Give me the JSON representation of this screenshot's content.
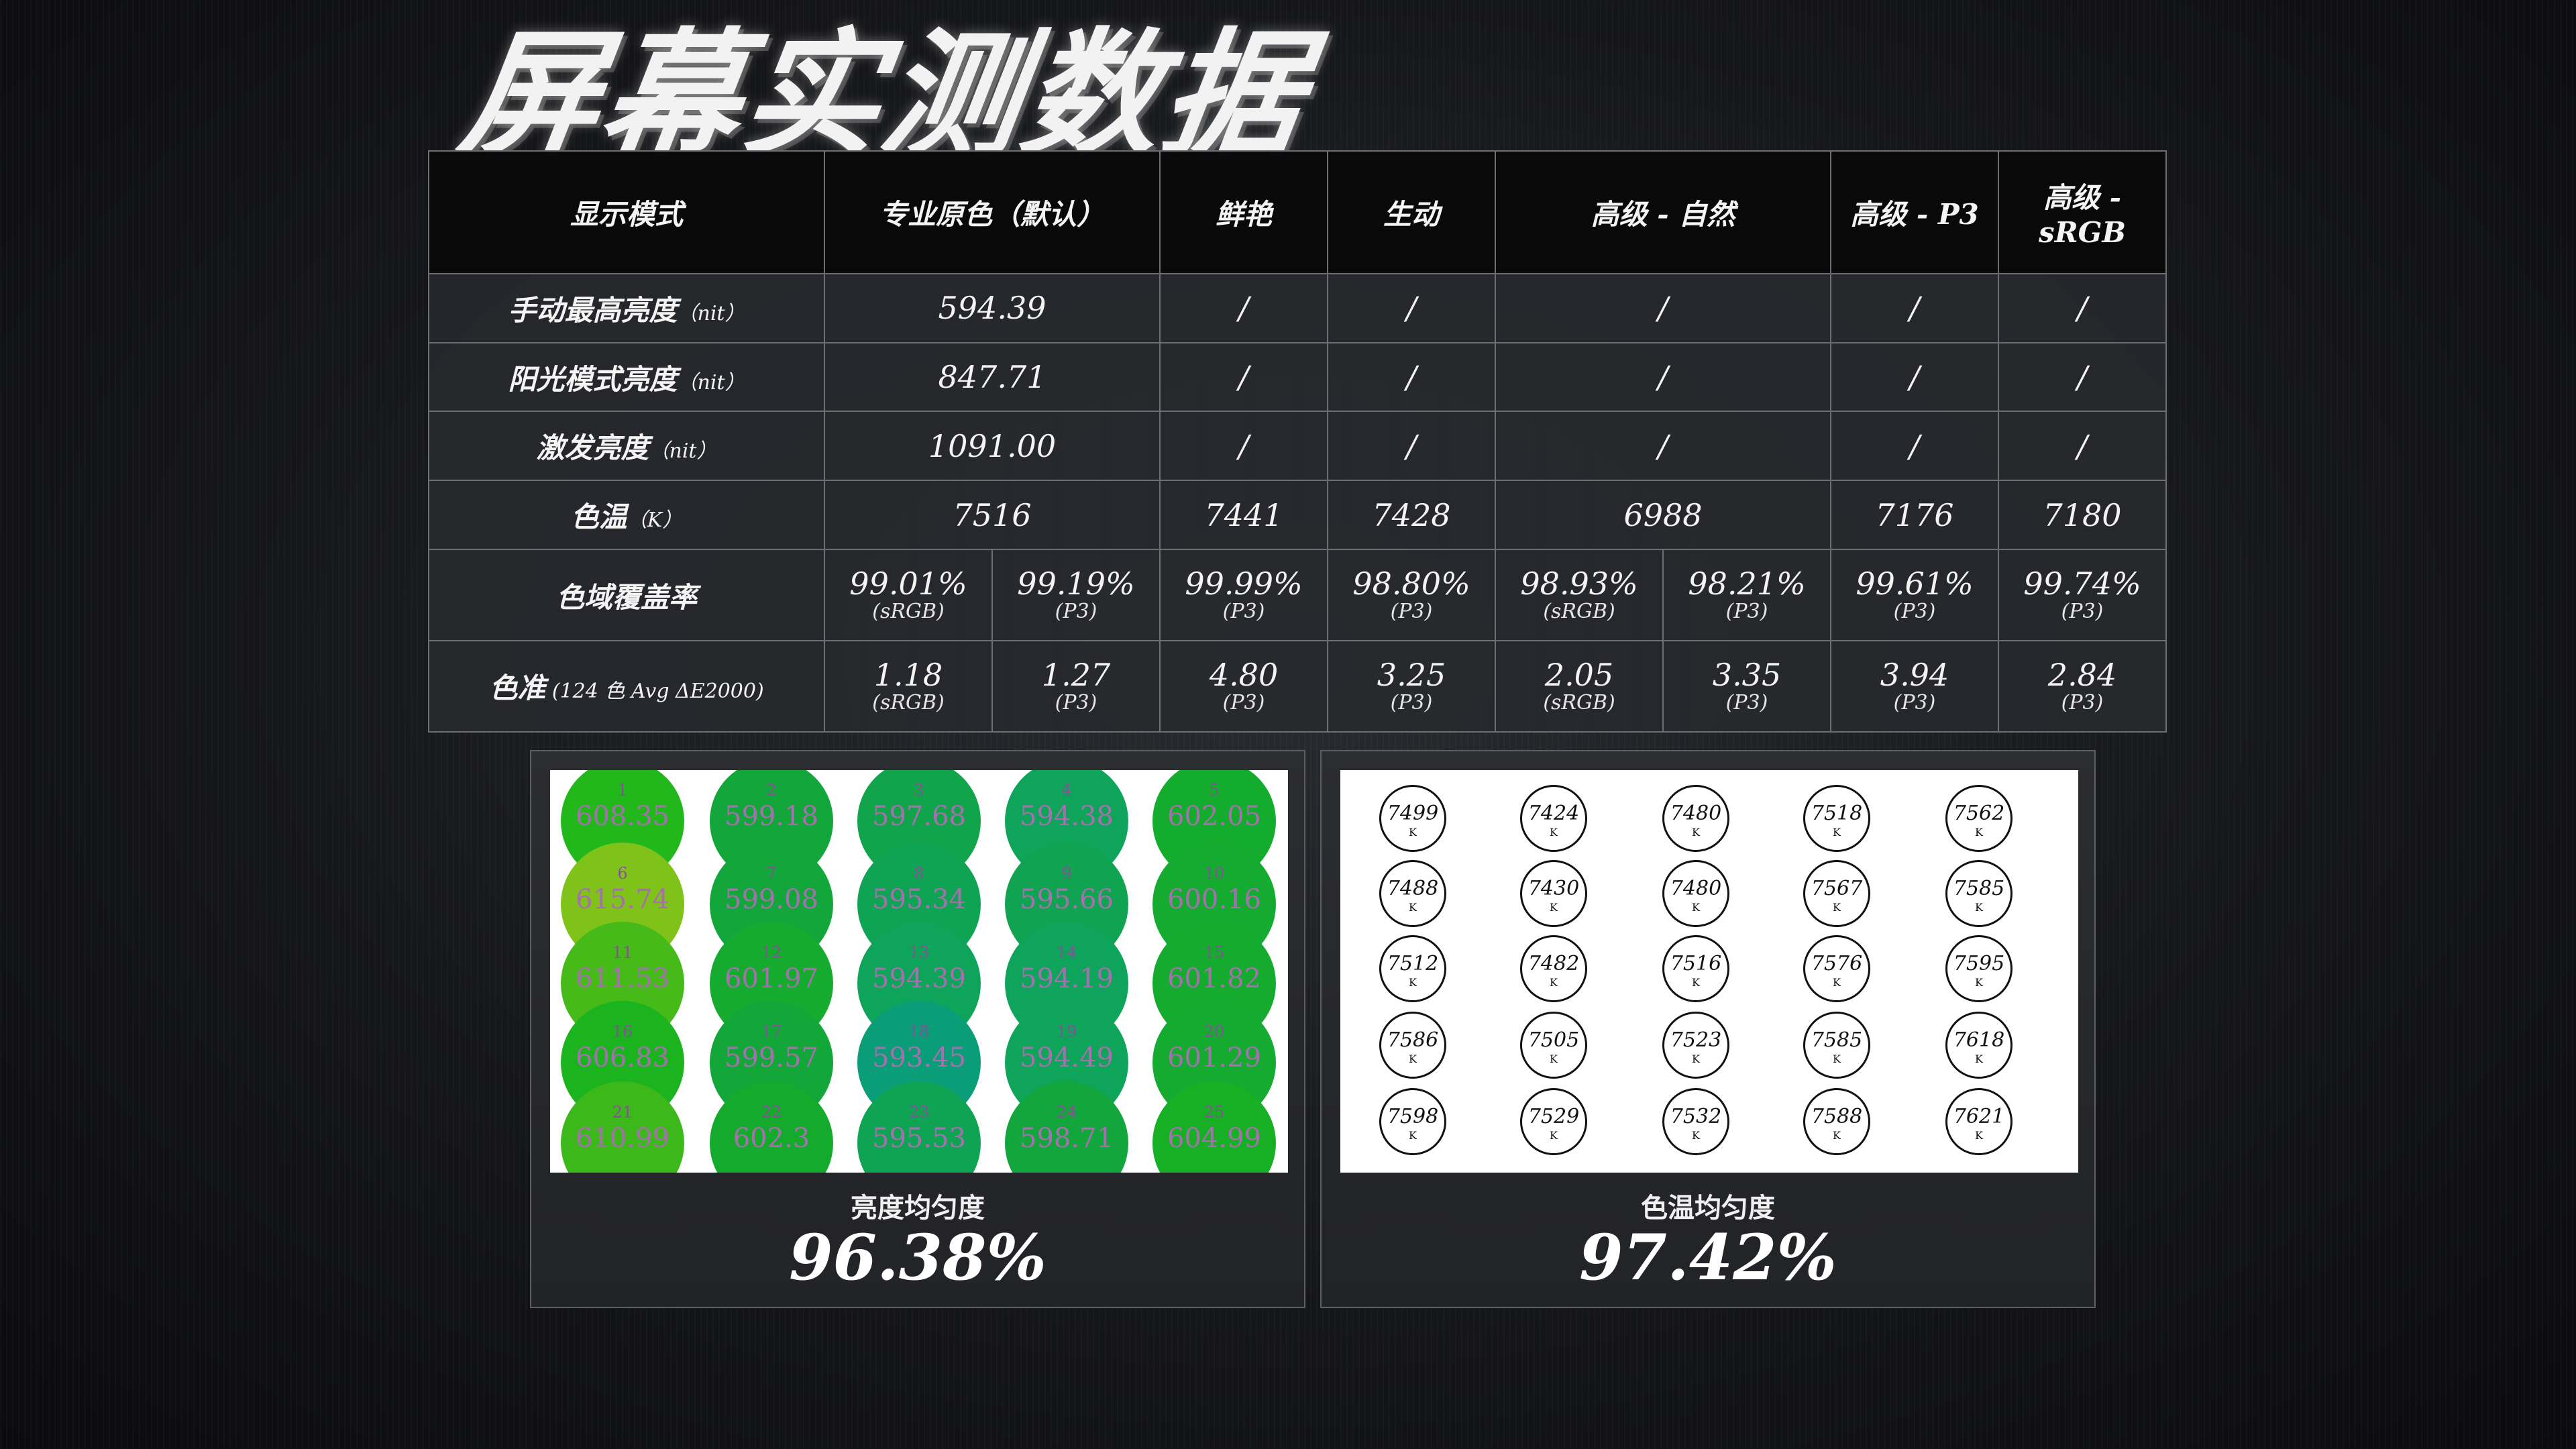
{
  "title": "屏幕实测数据",
  "header": [
    "显示模式",
    "专业原色（默认）",
    "鲜艳",
    "生动",
    "高级 - 自然",
    "高级 - P3",
    "高级 - sRGB"
  ],
  "rows": {
    "manual_brightness": {
      "label": "手动最高亮度",
      "unit": "（nit）",
      "values": [
        "594.39",
        "/",
        "/",
        "/",
        "/",
        "/"
      ]
    },
    "sunlight_brightness": {
      "label": "阳光模式亮度",
      "unit": "（nit）",
      "values": [
        "847.71",
        "/",
        "/",
        "/",
        "/",
        "/"
      ]
    },
    "boost_brightness": {
      "label": "激发亮度",
      "unit": "（nit）",
      "values": [
        "1091.00",
        "/",
        "/",
        "/",
        "/",
        "/"
      ]
    },
    "color_temp": {
      "label": "色温",
      "unit": "（K）",
      "values": [
        "7516",
        "7441",
        "7428",
        "6988",
        "7176",
        "7180"
      ]
    },
    "gamut": {
      "label": "色域覆盖率",
      "cells": [
        {
          "value": "99.01%",
          "space": "(sRGB)"
        },
        {
          "value": "99.19%",
          "space": "(P3)"
        },
        {
          "value": "99.99%",
          "space": "(P3)"
        },
        {
          "value": "98.80%",
          "space": "(P3)"
        },
        {
          "value": "98.93%",
          "space": "(sRGB)"
        },
        {
          "value": "98.21%",
          "space": "(P3)"
        },
        {
          "value": "99.61%",
          "space": "(P3)"
        },
        {
          "value": "99.74%",
          "space": "(P3)"
        }
      ]
    },
    "accuracy": {
      "label": "色准",
      "unit": " (124 色 Avg ΔE2000)",
      "cells": [
        {
          "value": "1.18",
          "space": "(sRGB)"
        },
        {
          "value": "1.27",
          "space": "(P3)"
        },
        {
          "value": "4.80",
          "space": "(P3)"
        },
        {
          "value": "3.25",
          "space": "(P3)"
        },
        {
          "value": "2.05",
          "space": "(sRGB)"
        },
        {
          "value": "3.35",
          "space": "(P3)"
        },
        {
          "value": "3.94",
          "space": "(P3)"
        },
        {
          "value": "2.84",
          "space": "(P3)"
        }
      ]
    }
  },
  "brightness_uniformity": {
    "label": "亮度均匀度",
    "value": "96.38%",
    "points": [
      {
        "index": "1",
        "value": "608.35",
        "color": "#22b81c"
      },
      {
        "index": "2",
        "value": "599.18",
        "color": "#13a63a"
      },
      {
        "index": "3",
        "value": "597.68",
        "color": "#11a44a"
      },
      {
        "index": "4",
        "value": "594.38",
        "color": "#0ea45a"
      },
      {
        "index": "5",
        "value": "602.05",
        "color": "#13ac2c"
      },
      {
        "index": "6",
        "value": "615.74",
        "color": "#7fc31a"
      },
      {
        "index": "7",
        "value": "599.08",
        "color": "#13a63a"
      },
      {
        "index": "8",
        "value": "595.34",
        "color": "#0fa454"
      },
      {
        "index": "9",
        "value": "595.66",
        "color": "#10a452"
      },
      {
        "index": "10",
        "value": "600.16",
        "color": "#14ab30"
      },
      {
        "index": "11",
        "value": "611.53",
        "color": "#45ba18"
      },
      {
        "index": "12",
        "value": "601.97",
        "color": "#14ab2e"
      },
      {
        "index": "13",
        "value": "594.39",
        "color": "#0ea45a"
      },
      {
        "index": "14",
        "value": "594.19",
        "color": "#0ea45c"
      },
      {
        "index": "15",
        "value": "601.82",
        "color": "#14ab2e"
      },
      {
        "index": "16",
        "value": "606.83",
        "color": "#1cb41e"
      },
      {
        "index": "17",
        "value": "599.57",
        "color": "#13a638"
      },
      {
        "index": "18",
        "value": "593.45",
        "color": "#0a9e78"
      },
      {
        "index": "19",
        "value": "594.49",
        "color": "#0ea45a"
      },
      {
        "index": "20",
        "value": "601.29",
        "color": "#14ab30"
      },
      {
        "index": "21",
        "value": "610.99",
        "color": "#3cb81a"
      },
      {
        "index": "22",
        "value": "602.3",
        "color": "#14ab2c"
      },
      {
        "index": "23",
        "value": "595.53",
        "color": "#0fa454"
      },
      {
        "index": "24",
        "value": "598.71",
        "color": "#12a63c"
      },
      {
        "index": "25",
        "value": "604.99",
        "color": "#17b024"
      }
    ]
  },
  "color_temp_uniformity": {
    "label": "色温均匀度",
    "value": "97.42%",
    "unit": "K",
    "points": [
      "7499",
      "7424",
      "7480",
      "7518",
      "7562",
      "7488",
      "7430",
      "7480",
      "7567",
      "7585",
      "7512",
      "7482",
      "7516",
      "7576",
      "7595",
      "7586",
      "7505",
      "7523",
      "7585",
      "7618",
      "7598",
      "7529",
      "7532",
      "7588",
      "7621"
    ]
  }
}
